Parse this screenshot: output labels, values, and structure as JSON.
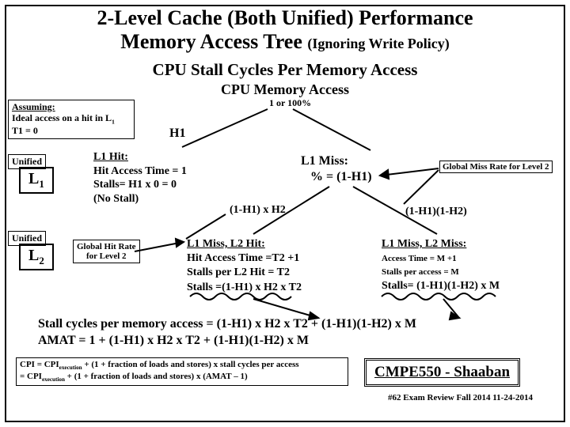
{
  "title1": "2-Level Cache (Both Unified) Performance",
  "title2_main": "Memory Access Tree",
  "title2_note": "(Ignoring Write Policy)",
  "sub1": "CPU  Stall Cycles Per Memory Access",
  "sub2": "CPU Memory  Access",
  "one_or": "1 or 100%",
  "assume": {
    "l1": "Assuming:",
    "l2": "Ideal access on a hit in L",
    "l2sub": "1",
    "l3": "T1 = 0"
  },
  "h1": "H1",
  "unified": "Unified",
  "L1": "L",
  "L1sub": "1",
  "L2": "L",
  "L2sub": "2",
  "l1hit": {
    "t": "L1 Hit:",
    "a": "Hit Access Time = 1",
    "b": "Stalls= H1 x 0 = 0",
    "c": "(No Stall)"
  },
  "l1miss": {
    "t": "L1  Miss:",
    "a": "%  =  (1-H1)"
  },
  "gmr": "Global Miss Rate for Level 2",
  "h2": "(1-H1)  x H2",
  "h2r": "(1-H1)(1-H2)",
  "ghr": {
    "a": "Global Hit Rate",
    "b": "for Level 2"
  },
  "l2hit": {
    "t": "L1 Miss, L2  Hit:",
    "a": "Hit Access Time =T2 +1",
    "b": "Stalls per L2 Hit = T2",
    "c": "Stalls =(1-H1) x H2 x T2"
  },
  "l2miss": {
    "t": "L1 Miss, L2   Miss:",
    "a": "Access Time  = M +1",
    "b": "Stalls per access = M",
    "c": "Stalls=  (1-H1)(1-H2) x M"
  },
  "eq": {
    "a": "Stall cycles per memory access    =   (1-H1) x H2 x T2    +   (1-H1)(1-H2) x M",
    "b": "AMAT  =  1  + (1-H1) x H2 x T2    +   (1-H1)(1-H2) x M"
  },
  "cpi": {
    "a": "CPI = CPI",
    "a_sub": "execution",
    "a2": "  +   (1 + fraction of loads and stores) x stall cycles per access",
    "b": "      = CPI",
    "b_sub": "execution",
    "b2": "  +  (1 + fraction of loads and stores) x (AMAT – 1)"
  },
  "course": "CMPE550 - Shaaban",
  "footer": "#62   Exam  Review   Fall 2014   11-24-2014"
}
